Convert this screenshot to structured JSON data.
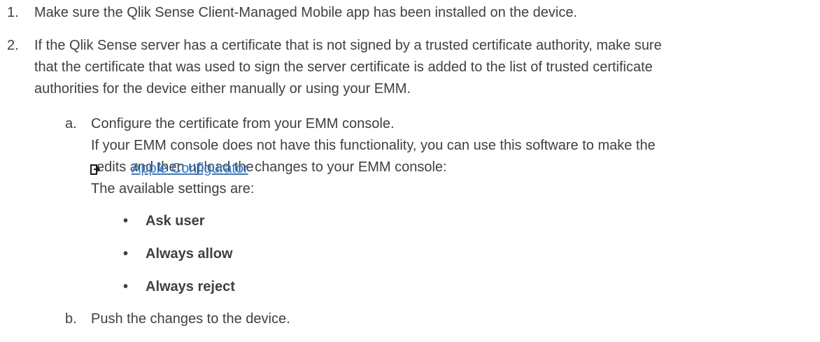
{
  "steps": [
    {
      "marker": "1.",
      "text": "Make sure the Qlik Sense Client-Managed Mobile app has been installed on the device."
    },
    {
      "marker": "2.",
      "lines": [
        "If the Qlik Sense server has a certificate that is not signed by a trusted certificate authority, make sure",
        "that the certificate that was used to sign the server certificate is added to the list of trusted certificate",
        "authorities for the device either manually or using your EMM."
      ]
    }
  ],
  "substeps": [
    {
      "marker": "a.",
      "lines": [
        "Configure the certificate from your EMM console.",
        "If your EMM console does not have this functionality, you can use this software to make the"
      ],
      "edits_line_prefix": "edits and then upload the",
      "edits_line_suffix": "changes to your EMM console:",
      "link_text": "Apple Configurator",
      "link_icon": "external-link-icon",
      "available_settings_label": "The available settings are:",
      "settings": [
        "Ask user",
        "Always allow",
        "Always reject"
      ],
      "bullet_glyph": "•"
    },
    {
      "marker": "b.",
      "text": "Push the changes to the device."
    }
  ],
  "colors": {
    "text": "#404040",
    "link": "#2f7bd1"
  }
}
